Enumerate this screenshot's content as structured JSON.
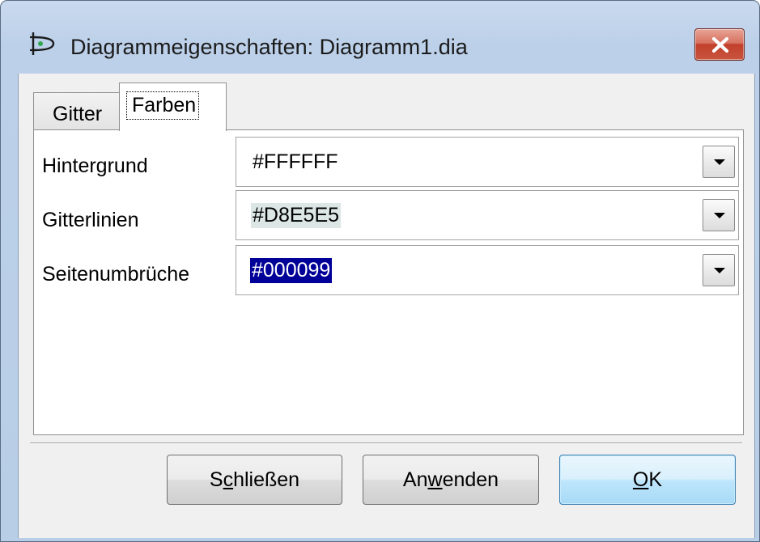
{
  "window": {
    "title": "Diagrammeigenschaften: Diagramm1.dia",
    "app_icon": "dia-diagram-icon",
    "close_icon": "close-icon"
  },
  "tabs": [
    {
      "label": "Gitter",
      "active": false
    },
    {
      "label": "Farben",
      "active": true
    }
  ],
  "fields": [
    {
      "label": "Hintergrund",
      "value": "#FFFFFF"
    },
    {
      "label": "Gitterlinien",
      "value": "#D8E5E5"
    },
    {
      "label": "Seitenumbrüche",
      "value": "#000099"
    }
  ],
  "buttons": {
    "close": {
      "pre": "S",
      "mnemonic": "c",
      "post": "hließen"
    },
    "apply": {
      "pre": "An",
      "mnemonic": "w",
      "post": "enden"
    },
    "ok": {
      "pre": "",
      "mnemonic": "O",
      "post": "K"
    }
  },
  "colors": {
    "title_bar": "#bcd0e9",
    "close_button": "#c9553e",
    "selection": "#000099",
    "gridline_value_bg": "#dbe6e5"
  }
}
